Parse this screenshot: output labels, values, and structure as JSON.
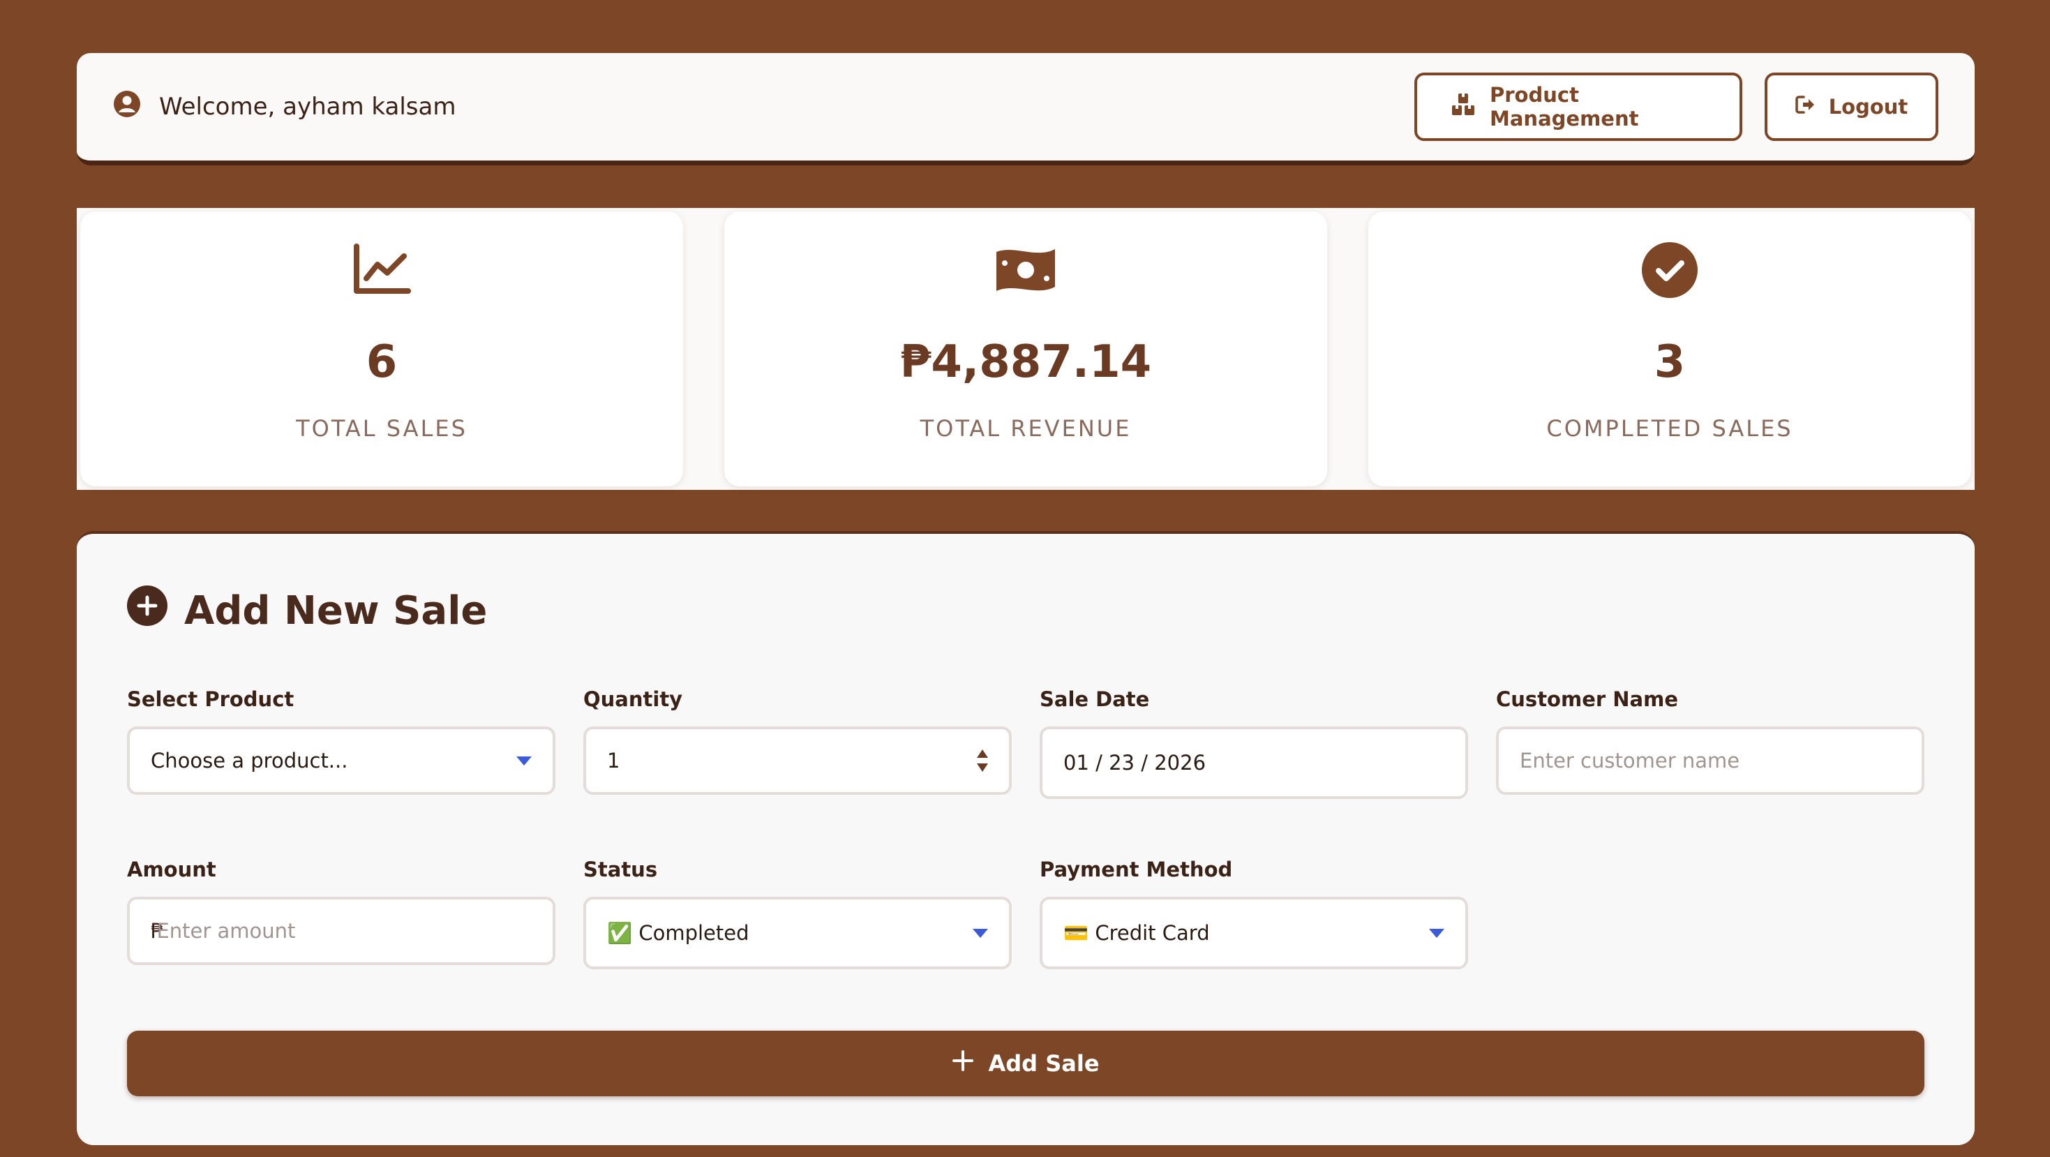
{
  "header": {
    "welcome_text": "Welcome, ayham kalsam",
    "product_management_label": "Product Management",
    "logout_label": "Logout"
  },
  "stats": [
    {
      "icon": "chart-line-icon",
      "value": "6",
      "label": "TOTAL SALES"
    },
    {
      "icon": "money-bill-icon",
      "value": "₱4,887.14",
      "label": "TOTAL REVENUE"
    },
    {
      "icon": "check-circle-icon",
      "value": "3",
      "label": "COMPLETED SALES"
    }
  ],
  "form": {
    "title": "Add New Sale",
    "product": {
      "label": "Select Product",
      "value": "Choose a product..."
    },
    "quantity": {
      "label": "Quantity",
      "value": "1"
    },
    "sale_date": {
      "label": "Sale Date",
      "value": "01 / 23 / 2026"
    },
    "customer": {
      "label": "Customer Name",
      "placeholder": "Enter customer name"
    },
    "amount": {
      "label": "Amount",
      "prefix": "₱",
      "placeholder": "Enter amount"
    },
    "status": {
      "label": "Status",
      "value": "✅ Completed"
    },
    "payment": {
      "label": "Payment Method",
      "value": "💳 Credit Card"
    },
    "submit_label": "Add Sale"
  },
  "colors": {
    "brand": "#7d4626",
    "dark": "#4a2a1c",
    "muted": "#8a6a5c",
    "select_caret": "#3b5bdb"
  }
}
